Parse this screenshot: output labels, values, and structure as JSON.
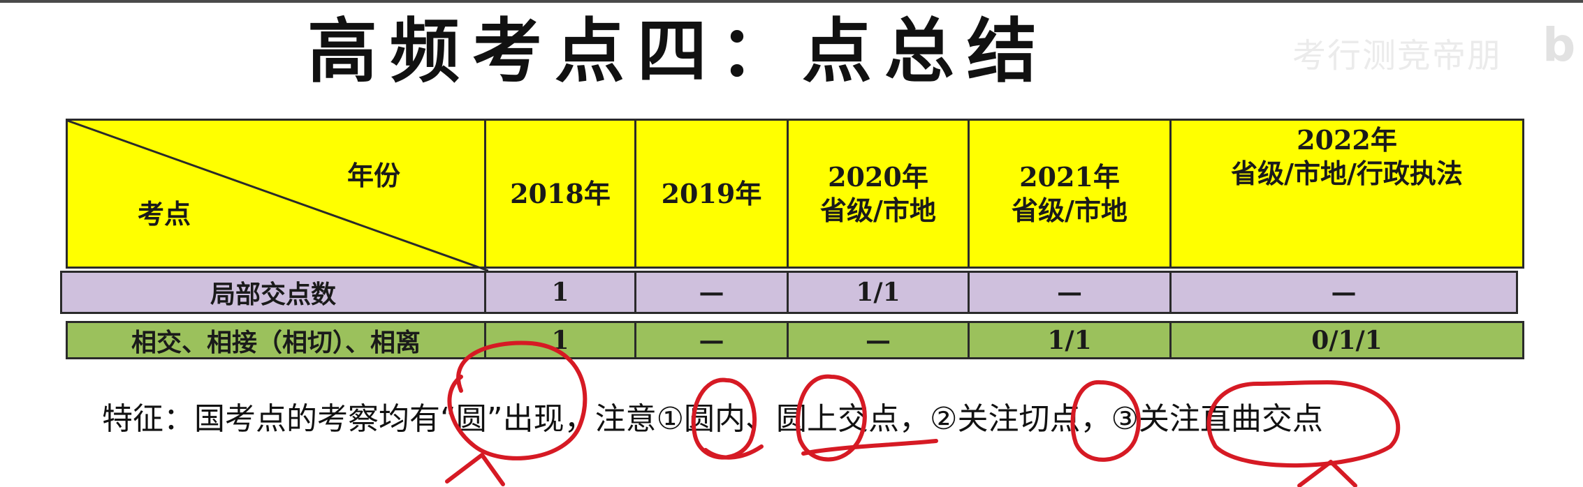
{
  "title": "高频考点四：点总结",
  "watermark": "考行测竞帝朋",
  "watermark_logo": "b",
  "table": {
    "corner_top_label": "年份",
    "corner_bottom_label": "考点",
    "columns": [
      {
        "line1": "2018年",
        "line2": ""
      },
      {
        "line1": "2019年",
        "line2": ""
      },
      {
        "line1": "2020年",
        "line2": "省级/市地"
      },
      {
        "line1": "2021年",
        "line2": "省级/市地"
      },
      {
        "line1": "2022年",
        "line2": "省级/市地/行政执法"
      }
    ],
    "rows": [
      {
        "label": "局部交点数",
        "cells": [
          "1",
          "—",
          "1/1",
          "—",
          "—"
        ]
      },
      {
        "label": "相交、相接（相切）、相离",
        "cells": [
          "1",
          "—",
          "—",
          "1/1",
          "0/1/1"
        ]
      }
    ]
  },
  "note": "特征：国考点的考察均有“圆”出现，注意①圆内、圆上交点，②关注切点，③关注直曲交点",
  "colors": {
    "header_bg": "#ffff00",
    "row1_bg": "#cfc0dd",
    "row2_bg": "#9bc15c",
    "annotation": "#d61a24"
  }
}
